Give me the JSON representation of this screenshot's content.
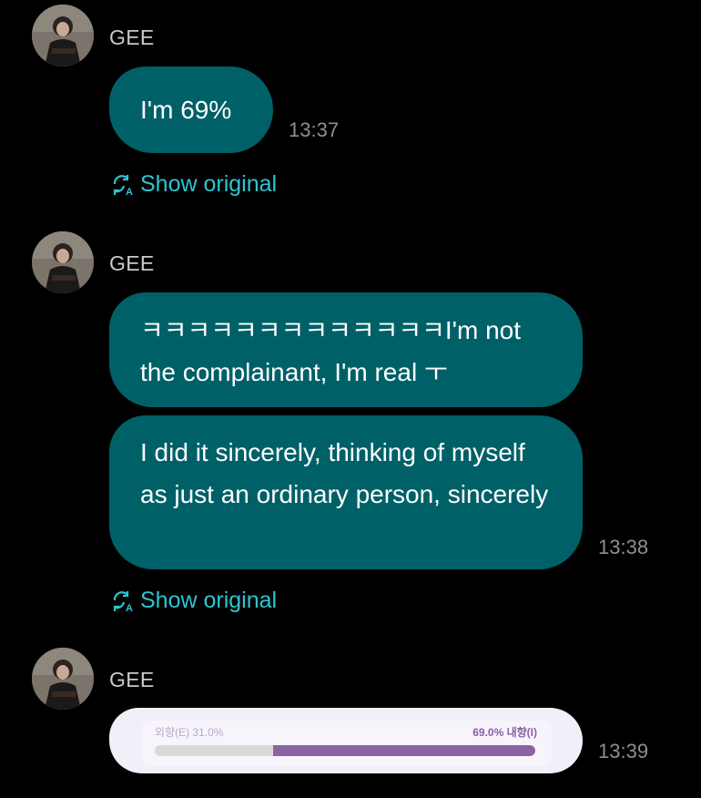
{
  "messages": [
    {
      "sender": "GEE",
      "texts": [
        "I'm 69%"
      ],
      "time": "13:37",
      "show_original": "Show original"
    },
    {
      "sender": "GEE",
      "texts": [
        "ㅋㅋㅋㅋㅋㅋㅋㅋㅋㅋㅋㅋㅋI'm not the complainant, I'm real ㅜ",
        "I did it sincerely, thinking of myself as just an ordinary person, sincerely"
      ],
      "time": "13:38",
      "show_original": "Show original"
    },
    {
      "sender": "GEE",
      "card": {
        "left_label": "외향(E) 31.0%",
        "right_label": "69.0% 내향(I)",
        "introvert_fraction": 0.69
      },
      "time": "13:39"
    }
  ],
  "colors": {
    "bubble": "#006068",
    "link": "#2ec5cf",
    "bar_fill": "#8a63a3"
  },
  "icons": [
    "translate-icon",
    "avatar-photo"
  ]
}
